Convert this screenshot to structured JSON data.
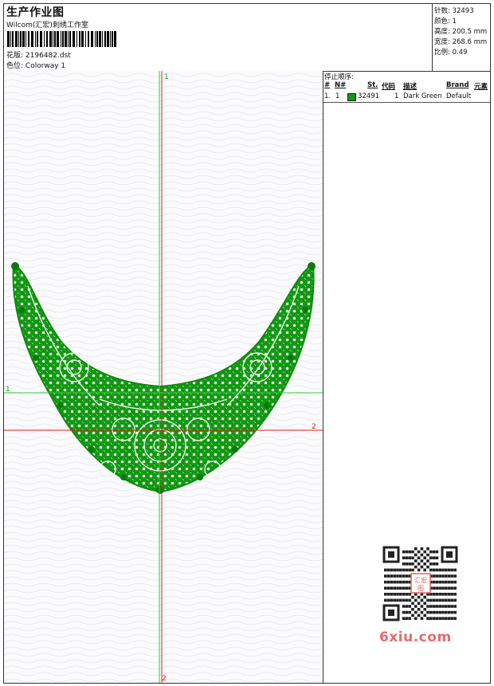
{
  "header": {
    "title": "生产作业图",
    "studio": "Wilcom(汇宏)刺绣工作室",
    "design_label": "花版:",
    "design_value": "2196482.dst",
    "colorway_label": "色位:",
    "colorway_value": "Colorway 1"
  },
  "stats": {
    "stitches": "针数: 32493",
    "colors": "颜色: 1",
    "height": "高度: 200.5 mm",
    "width": "宽度: 268.6 mm",
    "scale": "比例: 0.49"
  },
  "canvas": {
    "marker_top": "1",
    "marker_left": "1",
    "marker_right": "2",
    "marker_bottom": "2",
    "embroidery_color": "#119911",
    "guide_green": "#2fd02f",
    "guide_red": "#e02020"
  },
  "stop_sequence": {
    "title": "停止顺序:",
    "headers": [
      "#",
      "N#",
      "St.",
      "代码",
      "描述",
      "Brand",
      "元素"
    ],
    "rows": [
      {
        "index": "1.",
        "needle": "1",
        "stitches": "32491",
        "code": "1",
        "description": "Dark Green",
        "brand": "Default",
        "color": "#119911"
      }
    ]
  },
  "watermark": {
    "text": "6xiu.com",
    "stamp": "汇宏"
  }
}
